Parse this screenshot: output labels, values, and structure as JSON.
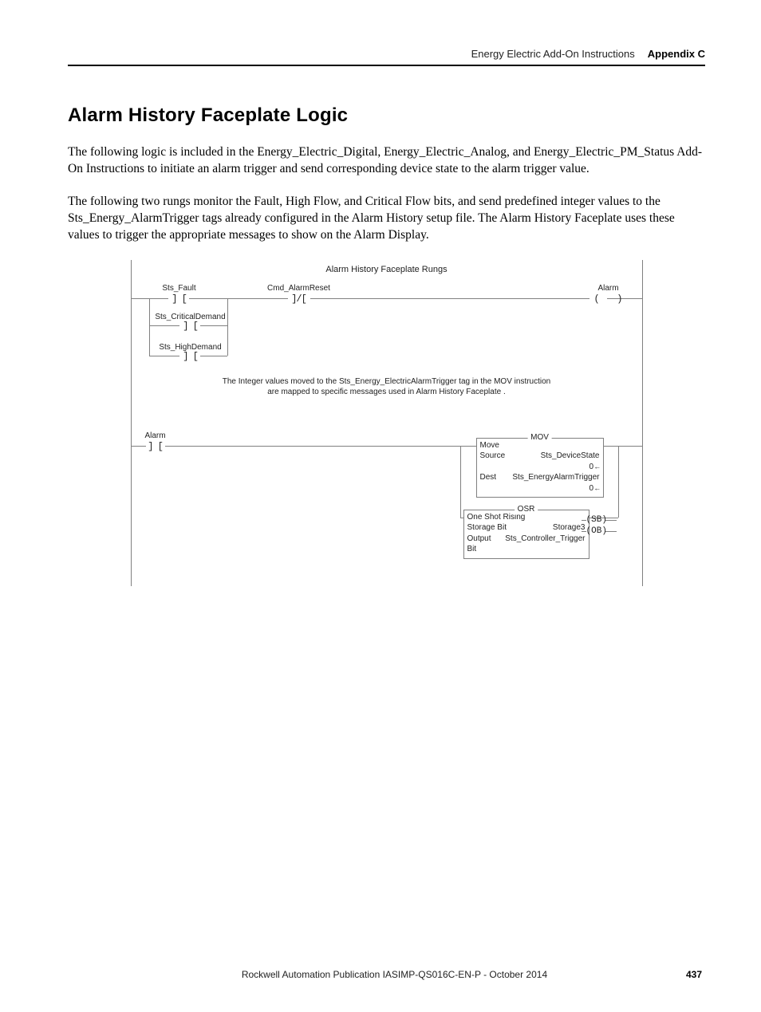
{
  "header": {
    "doc_title": "Energy Electric Add-On Instructions",
    "appendix": "Appendix C"
  },
  "heading": "Alarm History Faceplate Logic",
  "para1": "The following logic is included in the Energy_Electric_Digital, Energy_Electric_Analog, and Energy_Electric_PM_Status Add-On Instructions to initiate an alarm trigger and send corresponding device state to the alarm trigger value.",
  "para2": "The following two rungs monitor the Fault, High Flow, and Critical Flow bits, and send predefined integer values to the Sts_Energy_AlarmTrigger tags already configured in the Alarm History setup file. The Alarm History Faceplate uses these values to trigger the appropriate messages to show on the Alarm Display.",
  "figure": {
    "title": "Alarm History Faceplate Rungs",
    "labels": {
      "sts_fault": "Sts_Fault",
      "cmd_alarm_reset": "Cmd_AlarmReset",
      "alarm": "Alarm",
      "sts_critical": "Sts_CriticalDemand",
      "sts_high": "Sts_HighDemand"
    },
    "note_line1": "The Integer values moved to the Sts_Energy_ElectricAlarmTrigger tag in the MOV instruction",
    "note_line2": "are mapped to specific messages used in Alarm History Faceplate .",
    "mov": {
      "title": "MOV",
      "name": "Move",
      "source_lbl": "Source",
      "source_val": "Sts_DeviceState",
      "source_num": "0",
      "dest_lbl": "Dest",
      "dest_val": "Sts_EnergyAlarmTrigger",
      "dest_num": "0"
    },
    "osr": {
      "title": "OSR",
      "name": "One Shot Rising",
      "storage_lbl": "Storage Bit",
      "storage_val": "Storage3",
      "output_lbl": "Output Bit",
      "output_val": "Sts_Controller_Trigger",
      "sb": "SB",
      "ob": "OB"
    }
  },
  "footer": {
    "publication": "Rockwell Automation Publication IASIMP-QS016C-EN-P - October 2014",
    "page": "437"
  }
}
